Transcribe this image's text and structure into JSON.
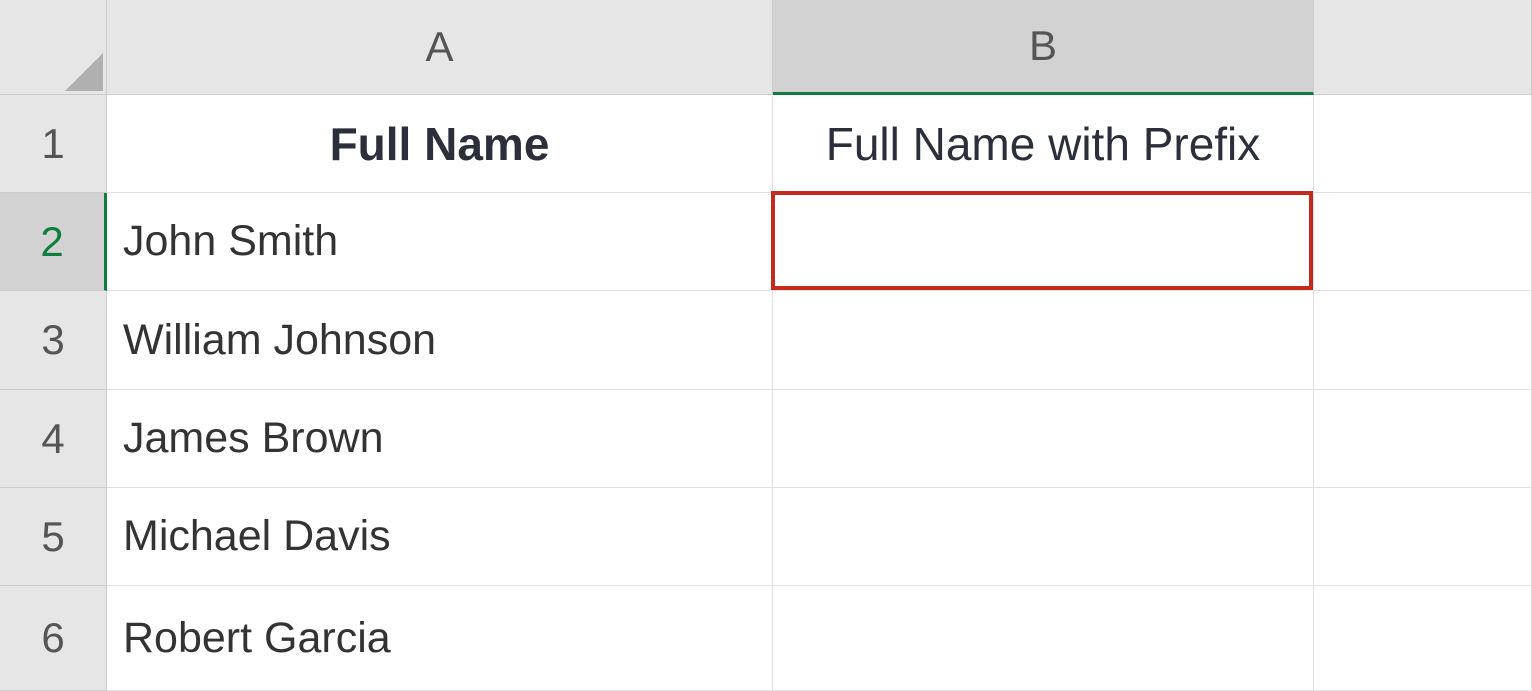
{
  "columns": {
    "a": "A",
    "b": "B"
  },
  "rows": {
    "r1": "1",
    "r2": "2",
    "r3": "3",
    "r4": "4",
    "r5": "5",
    "r6": "6"
  },
  "headers": {
    "col_a": "Full Name",
    "col_b": "Full Name with Prefix"
  },
  "data": {
    "a2": "John Smith",
    "a3": "William Johnson",
    "a4": "James Brown",
    "a5": "Michael Davis",
    "a6": "Robert Garcia",
    "b2": "",
    "b3": "",
    "b4": "",
    "b5": "",
    "b6": ""
  }
}
